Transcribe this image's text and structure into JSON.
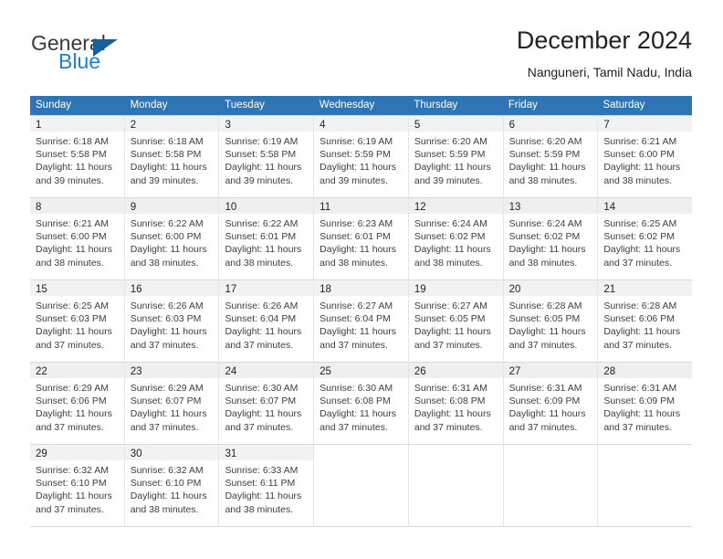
{
  "logo": {
    "word_top": "General",
    "word_bottom": "Blue",
    "triangle_color": "#14619e",
    "blue_color": "#1b7fd4"
  },
  "header": {
    "title": "December 2024",
    "location": "Nanguneri, Tamil Nadu, India"
  },
  "theme": {
    "header_bg": "#2e75b6",
    "header_text": "#ffffff",
    "row_shade": "#efefef",
    "daynum_bar": "#f2f2f2",
    "grid_line": "#d9d9d9"
  },
  "weekdays": [
    "Sunday",
    "Monday",
    "Tuesday",
    "Wednesday",
    "Thursday",
    "Friday",
    "Saturday"
  ],
  "weeks": [
    {
      "shaded": false,
      "days": [
        {
          "num": "1",
          "sunrise": "Sunrise: 6:18 AM",
          "sunset": "Sunset: 5:58 PM",
          "daylight1": "Daylight: 11 hours",
          "daylight2": "and 39 minutes."
        },
        {
          "num": "2",
          "sunrise": "Sunrise: 6:18 AM",
          "sunset": "Sunset: 5:58 PM",
          "daylight1": "Daylight: 11 hours",
          "daylight2": "and 39 minutes."
        },
        {
          "num": "3",
          "sunrise": "Sunrise: 6:19 AM",
          "sunset": "Sunset: 5:58 PM",
          "daylight1": "Daylight: 11 hours",
          "daylight2": "and 39 minutes."
        },
        {
          "num": "4",
          "sunrise": "Sunrise: 6:19 AM",
          "sunset": "Sunset: 5:59 PM",
          "daylight1": "Daylight: 11 hours",
          "daylight2": "and 39 minutes."
        },
        {
          "num": "5",
          "sunrise": "Sunrise: 6:20 AM",
          "sunset": "Sunset: 5:59 PM",
          "daylight1": "Daylight: 11 hours",
          "daylight2": "and 39 minutes."
        },
        {
          "num": "6",
          "sunrise": "Sunrise: 6:20 AM",
          "sunset": "Sunset: 5:59 PM",
          "daylight1": "Daylight: 11 hours",
          "daylight2": "and 38 minutes."
        },
        {
          "num": "7",
          "sunrise": "Sunrise: 6:21 AM",
          "sunset": "Sunset: 6:00 PM",
          "daylight1": "Daylight: 11 hours",
          "daylight2": "and 38 minutes."
        }
      ]
    },
    {
      "shaded": true,
      "days": [
        {
          "num": "8",
          "sunrise": "Sunrise: 6:21 AM",
          "sunset": "Sunset: 6:00 PM",
          "daylight1": "Daylight: 11 hours",
          "daylight2": "and 38 minutes."
        },
        {
          "num": "9",
          "sunrise": "Sunrise: 6:22 AM",
          "sunset": "Sunset: 6:00 PM",
          "daylight1": "Daylight: 11 hours",
          "daylight2": "and 38 minutes."
        },
        {
          "num": "10",
          "sunrise": "Sunrise: 6:22 AM",
          "sunset": "Sunset: 6:01 PM",
          "daylight1": "Daylight: 11 hours",
          "daylight2": "and 38 minutes."
        },
        {
          "num": "11",
          "sunrise": "Sunrise: 6:23 AM",
          "sunset": "Sunset: 6:01 PM",
          "daylight1": "Daylight: 11 hours",
          "daylight2": "and 38 minutes."
        },
        {
          "num": "12",
          "sunrise": "Sunrise: 6:24 AM",
          "sunset": "Sunset: 6:02 PM",
          "daylight1": "Daylight: 11 hours",
          "daylight2": "and 38 minutes."
        },
        {
          "num": "13",
          "sunrise": "Sunrise: 6:24 AM",
          "sunset": "Sunset: 6:02 PM",
          "daylight1": "Daylight: 11 hours",
          "daylight2": "and 38 minutes."
        },
        {
          "num": "14",
          "sunrise": "Sunrise: 6:25 AM",
          "sunset": "Sunset: 6:02 PM",
          "daylight1": "Daylight: 11 hours",
          "daylight2": "and 37 minutes."
        }
      ]
    },
    {
      "shaded": false,
      "days": [
        {
          "num": "15",
          "sunrise": "Sunrise: 6:25 AM",
          "sunset": "Sunset: 6:03 PM",
          "daylight1": "Daylight: 11 hours",
          "daylight2": "and 37 minutes."
        },
        {
          "num": "16",
          "sunrise": "Sunrise: 6:26 AM",
          "sunset": "Sunset: 6:03 PM",
          "daylight1": "Daylight: 11 hours",
          "daylight2": "and 37 minutes."
        },
        {
          "num": "17",
          "sunrise": "Sunrise: 6:26 AM",
          "sunset": "Sunset: 6:04 PM",
          "daylight1": "Daylight: 11 hours",
          "daylight2": "and 37 minutes."
        },
        {
          "num": "18",
          "sunrise": "Sunrise: 6:27 AM",
          "sunset": "Sunset: 6:04 PM",
          "daylight1": "Daylight: 11 hours",
          "daylight2": "and 37 minutes."
        },
        {
          "num": "19",
          "sunrise": "Sunrise: 6:27 AM",
          "sunset": "Sunset: 6:05 PM",
          "daylight1": "Daylight: 11 hours",
          "daylight2": "and 37 minutes."
        },
        {
          "num": "20",
          "sunrise": "Sunrise: 6:28 AM",
          "sunset": "Sunset: 6:05 PM",
          "daylight1": "Daylight: 11 hours",
          "daylight2": "and 37 minutes."
        },
        {
          "num": "21",
          "sunrise": "Sunrise: 6:28 AM",
          "sunset": "Sunset: 6:06 PM",
          "daylight1": "Daylight: 11 hours",
          "daylight2": "and 37 minutes."
        }
      ]
    },
    {
      "shaded": true,
      "days": [
        {
          "num": "22",
          "sunrise": "Sunrise: 6:29 AM",
          "sunset": "Sunset: 6:06 PM",
          "daylight1": "Daylight: 11 hours",
          "daylight2": "and 37 minutes."
        },
        {
          "num": "23",
          "sunrise": "Sunrise: 6:29 AM",
          "sunset": "Sunset: 6:07 PM",
          "daylight1": "Daylight: 11 hours",
          "daylight2": "and 37 minutes."
        },
        {
          "num": "24",
          "sunrise": "Sunrise: 6:30 AM",
          "sunset": "Sunset: 6:07 PM",
          "daylight1": "Daylight: 11 hours",
          "daylight2": "and 37 minutes."
        },
        {
          "num": "25",
          "sunrise": "Sunrise: 6:30 AM",
          "sunset": "Sunset: 6:08 PM",
          "daylight1": "Daylight: 11 hours",
          "daylight2": "and 37 minutes."
        },
        {
          "num": "26",
          "sunrise": "Sunrise: 6:31 AM",
          "sunset": "Sunset: 6:08 PM",
          "daylight1": "Daylight: 11 hours",
          "daylight2": "and 37 minutes."
        },
        {
          "num": "27",
          "sunrise": "Sunrise: 6:31 AM",
          "sunset": "Sunset: 6:09 PM",
          "daylight1": "Daylight: 11 hours",
          "daylight2": "and 37 minutes."
        },
        {
          "num": "28",
          "sunrise": "Sunrise: 6:31 AM",
          "sunset": "Sunset: 6:09 PM",
          "daylight1": "Daylight: 11 hours",
          "daylight2": "and 37 minutes."
        }
      ]
    },
    {
      "shaded": false,
      "days": [
        {
          "num": "29",
          "sunrise": "Sunrise: 6:32 AM",
          "sunset": "Sunset: 6:10 PM",
          "daylight1": "Daylight: 11 hours",
          "daylight2": "and 37 minutes."
        },
        {
          "num": "30",
          "sunrise": "Sunrise: 6:32 AM",
          "sunset": "Sunset: 6:10 PM",
          "daylight1": "Daylight: 11 hours",
          "daylight2": "and 38 minutes."
        },
        {
          "num": "31",
          "sunrise": "Sunrise: 6:33 AM",
          "sunset": "Sunset: 6:11 PM",
          "daylight1": "Daylight: 11 hours",
          "daylight2": "and 38 minutes."
        },
        {
          "num": "",
          "sunrise": "",
          "sunset": "",
          "daylight1": "",
          "daylight2": ""
        },
        {
          "num": "",
          "sunrise": "",
          "sunset": "",
          "daylight1": "",
          "daylight2": ""
        },
        {
          "num": "",
          "sunrise": "",
          "sunset": "",
          "daylight1": "",
          "daylight2": ""
        },
        {
          "num": "",
          "sunrise": "",
          "sunset": "",
          "daylight1": "",
          "daylight2": ""
        }
      ]
    }
  ]
}
